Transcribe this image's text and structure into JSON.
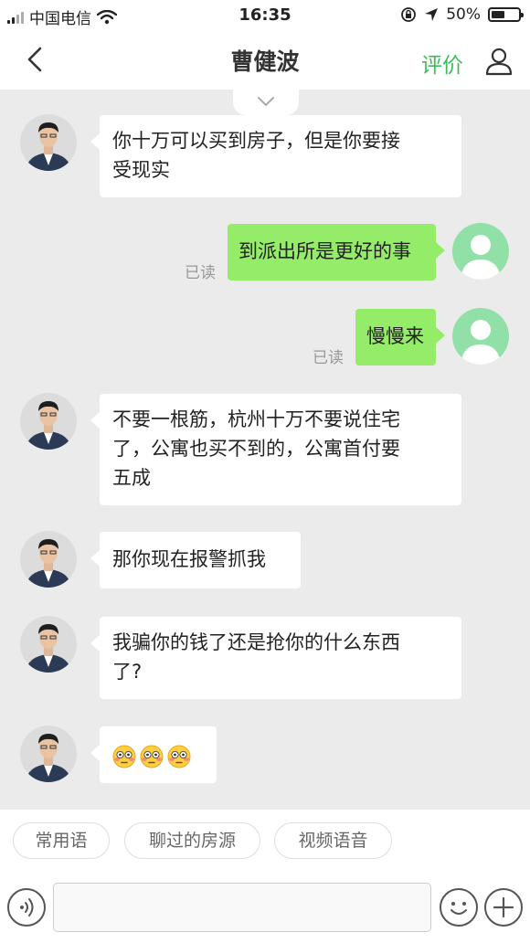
{
  "status_bar": {
    "carrier": "中国电信",
    "time": "16:35",
    "battery": "50%",
    "battery_level": 0.5
  },
  "nav": {
    "title": "曹健波",
    "rate_label": "评价"
  },
  "messages": [
    {
      "side": "left",
      "lines": [
        "你十万可以买到房子，但是你要接",
        "受现实"
      ]
    },
    {
      "side": "right",
      "text": "到派出所是更好的事",
      "status": "已读"
    },
    {
      "side": "right",
      "text": "慢慢来",
      "status": "已读"
    },
    {
      "side": "left",
      "lines": [
        "不要一根筋，杭州十万不要说住宅",
        "了，公寓也买不到的，公寓首付要",
        "五成"
      ]
    },
    {
      "side": "left",
      "text": "那你现在报警抓我"
    },
    {
      "side": "left",
      "lines": [
        "我骗你的钱了还是抢你的什么东西",
        "了?"
      ]
    },
    {
      "side": "left",
      "emojis": [
        "flushed-face",
        "flushed-face",
        "flushed-face"
      ]
    }
  ],
  "quick_replies": [
    "常用语",
    "聊过的房源",
    "视频语音"
  ],
  "input": {
    "placeholder": ""
  },
  "colors": {
    "accent": "#3cbc5b",
    "my_bubble": "#95ec69",
    "their_bubble": "#ffffff",
    "background": "#ebebeb"
  }
}
